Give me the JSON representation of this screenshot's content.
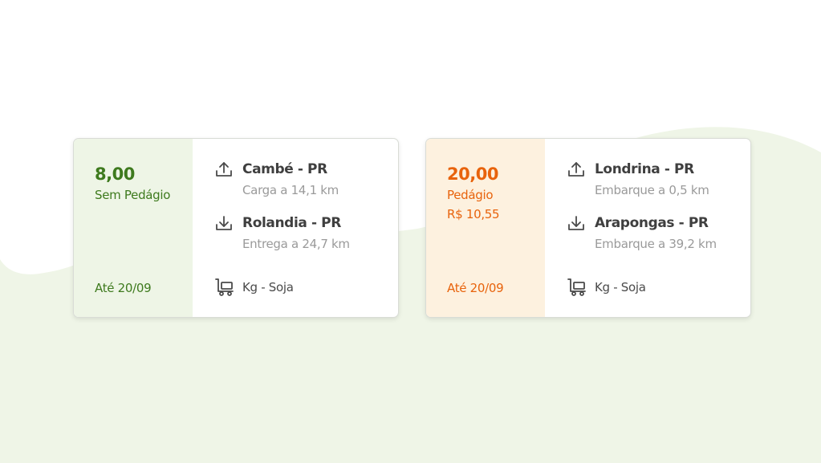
{
  "colors": {
    "background": "#ffffff",
    "wave": "#eff5e7",
    "green_accent": "#3e7a1e",
    "green_panel": "#eef5e6",
    "orange_accent": "#e8630c",
    "orange_panel": "#fdf1df"
  },
  "cards": [
    {
      "price": "8,00",
      "toll_label": "Sem Pedágio",
      "toll_value": "",
      "deadline": "Até 20/09",
      "pickup": {
        "city": "Cambé - PR",
        "detail": "Carga a 14,1 km",
        "icon": "upload-icon"
      },
      "dropoff": {
        "city": "Rolandia - PR",
        "detail": "Entrega a 24,7 km",
        "icon": "download-icon"
      },
      "cargo": {
        "text": "Kg - Soja",
        "icon": "hand-truck-icon"
      }
    },
    {
      "price": "20,00",
      "toll_label": "Pedágio",
      "toll_value": "R$ 10,55",
      "deadline": "Até 20/09",
      "pickup": {
        "city": "Londrina - PR",
        "detail": "Embarque a 0,5 km",
        "icon": "upload-icon"
      },
      "dropoff": {
        "city": "Arapongas - PR",
        "detail": "Embarque a 39,2 km",
        "icon": "download-icon"
      },
      "cargo": {
        "text": "Kg - Soja",
        "icon": "hand-truck-icon"
      }
    }
  ]
}
